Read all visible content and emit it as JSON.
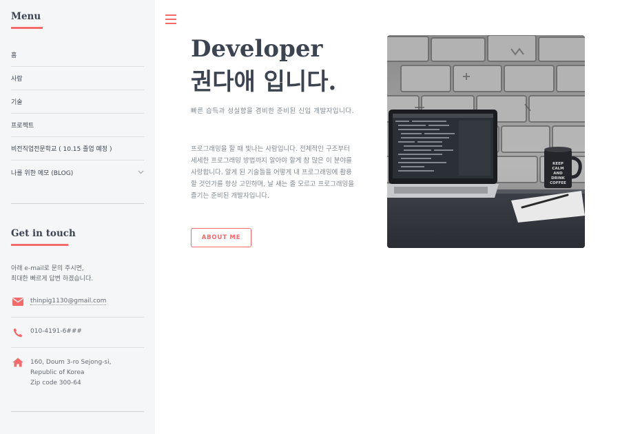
{
  "sidebar": {
    "menu_title": "Menu",
    "menu_items": [
      {
        "label": "홈"
      },
      {
        "label": "사람"
      },
      {
        "label": "기술"
      },
      {
        "label": "프로젝트"
      },
      {
        "label": "비전직업전문학교 ( 10.15 졸업 예정 )"
      },
      {
        "label": "나를 위한 메모 (BLOG)",
        "icon": "chevron-down-icon"
      }
    ],
    "contact_title": "Get in touch",
    "contact_desc_line1": "아래 e-mail로 문의 주시면,",
    "contact_desc_line2": "최대한 빠르게 답변 하겠습니다.",
    "email": "thinpig1130@gmail.com",
    "phone": "010-4191-6###",
    "address_line1": "160, Doum 3-ro Sejong-si,",
    "address_line2": "Republic of Korea",
    "address_line3": "Zip code 300-64"
  },
  "main": {
    "headline_line1": "Developer",
    "headline_line2": "권다애 입니다.",
    "tagline": "빠른 습득과 성실함을 겸비한 준비된 신입 개발자입니다.",
    "body": "프로그래밍을 할 때 빛나는 사람입니다. 전체적인 구조부터 세세한 프로그래밍 방법까지 알아야 할게 참 많은 이 분야를 사랑합니다. 알게 된 기술들을 어떻게 내 프로그래밍에 활용할 것인가를 항상 고민하며, 날 새는 줄 모르고 프로그래밍을 즐기는 준비된 개발자입니다.",
    "button_label": "ABOUT ME",
    "image_mug_text": "KEEP CALM AND DRINK COFFEE"
  },
  "colors": {
    "accent": "#f56a6a",
    "sidebar_bg": "#f5f6f7",
    "heading": "#3d4451",
    "text": "#7f888f"
  }
}
